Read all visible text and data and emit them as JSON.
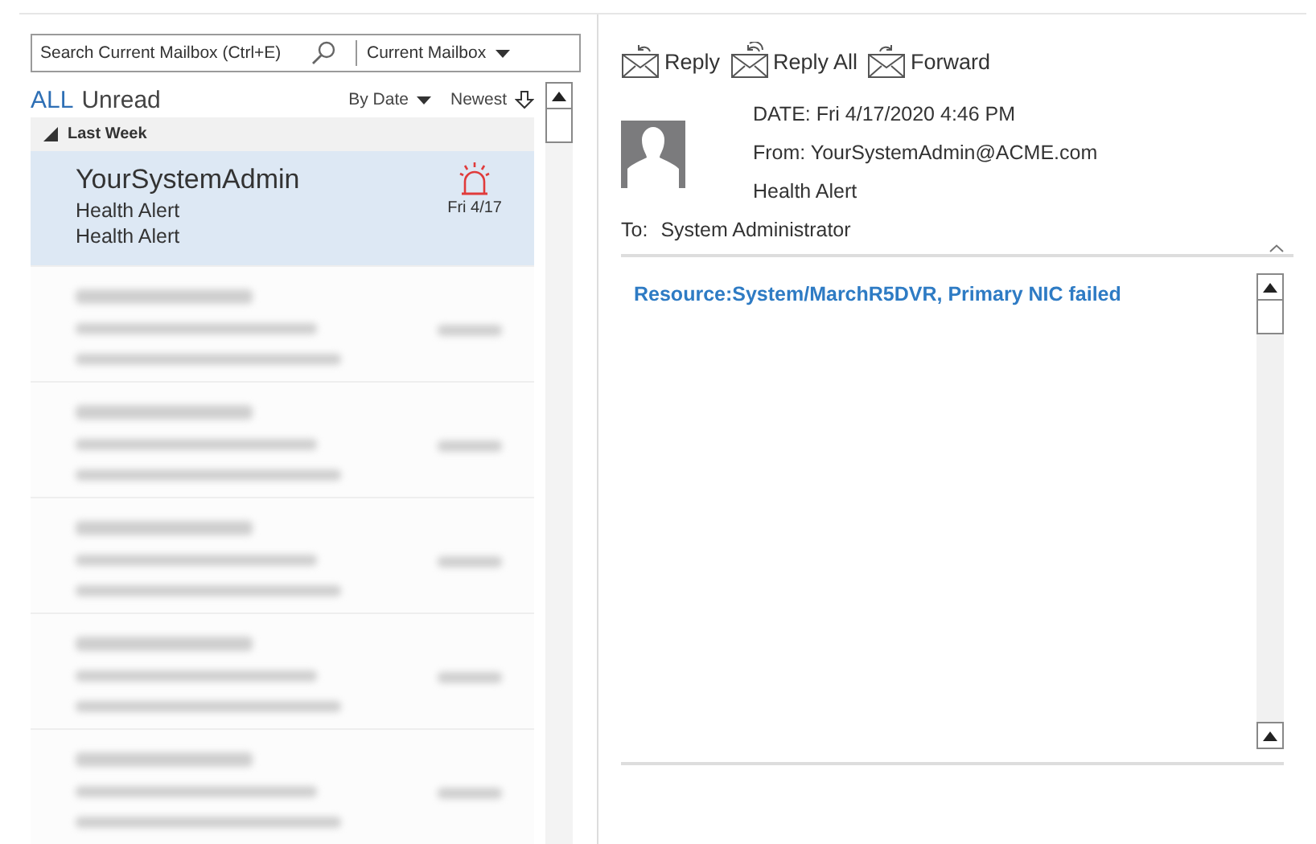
{
  "search": {
    "placeholder": "Search Current Mailbox (Ctrl+E)",
    "scope": "Current Mailbox"
  },
  "filters": [
    {
      "label": "ALL",
      "selected": true
    },
    {
      "label": "Unread",
      "selected": false
    }
  ],
  "sort": {
    "by": "By Date",
    "order": "Newest"
  },
  "group": {
    "label": "Last Week",
    "expanded": true
  },
  "messages": [
    {
      "kind": "mail",
      "sender": "YourSystemAdmin",
      "subject": "Health Alert",
      "preview": "Health Alert",
      "date": "Fri 4/17",
      "selected": true
    },
    {
      "kind": "blurred",
      "selected": false
    },
    {
      "kind": "blurred",
      "selected": false
    },
    {
      "kind": "blurred",
      "selected": false
    },
    {
      "kind": "blurred",
      "selected": false
    },
    {
      "kind": "blurred",
      "selected": false
    }
  ],
  "toolbar": [
    "Reply",
    "Reply All",
    "Forward"
  ],
  "header": {
    "date": "DATE: Fri 4/17/2020 4:46 PM",
    "from": "From: YourSystemAdmin@ACME.com",
    "subject": "Health Alert",
    "to_label": "To:",
    "to": "System Administrator"
  },
  "body": {
    "text": "Resource:System/MarchR5DVR, Primary NIC failed"
  }
}
